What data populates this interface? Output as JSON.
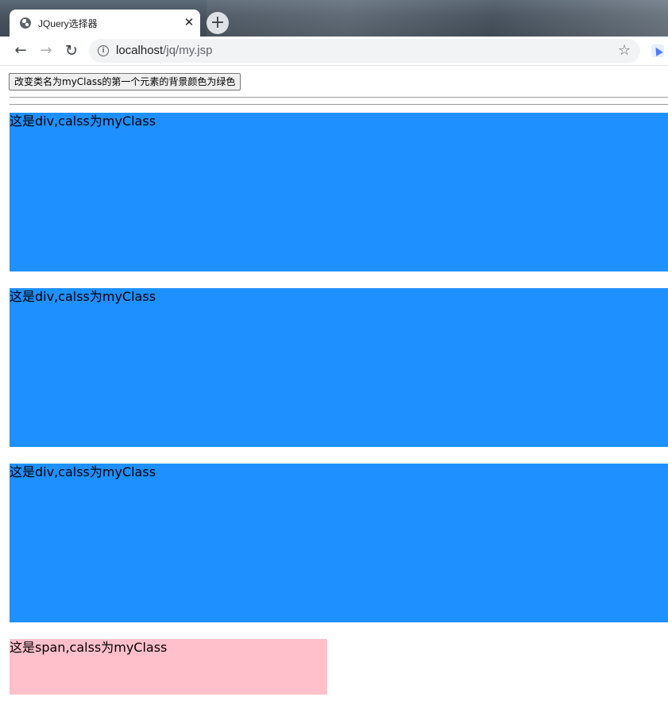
{
  "browser": {
    "tab": {
      "favicon": "globe-icon",
      "title": "JQuery选择器",
      "close_glyph": "✕"
    },
    "new_tab_glyph": "+",
    "toolbar": {
      "back_glyph": "←",
      "forward_glyph": "→",
      "reload_glyph": "↻",
      "info_glyph": "i",
      "url_host": "localhost",
      "url_path": "/jq/my.jsp",
      "bookmark_glyph": "☆",
      "extension_icon": "extension-icon"
    }
  },
  "page": {
    "button_label": "改变类名为myClass的第一个元素的背景颜色为绿色",
    "blocks": [
      {
        "text": "这是div,calss为myClass"
      },
      {
        "text": "这是div,calss为myClass"
      },
      {
        "text": "这是div,calss为myClass"
      }
    ],
    "span": {
      "text": "这是span,calss为myClass"
    }
  },
  "colors": {
    "div_background": "#1e90ff",
    "span_background": "#ffc0cb"
  }
}
